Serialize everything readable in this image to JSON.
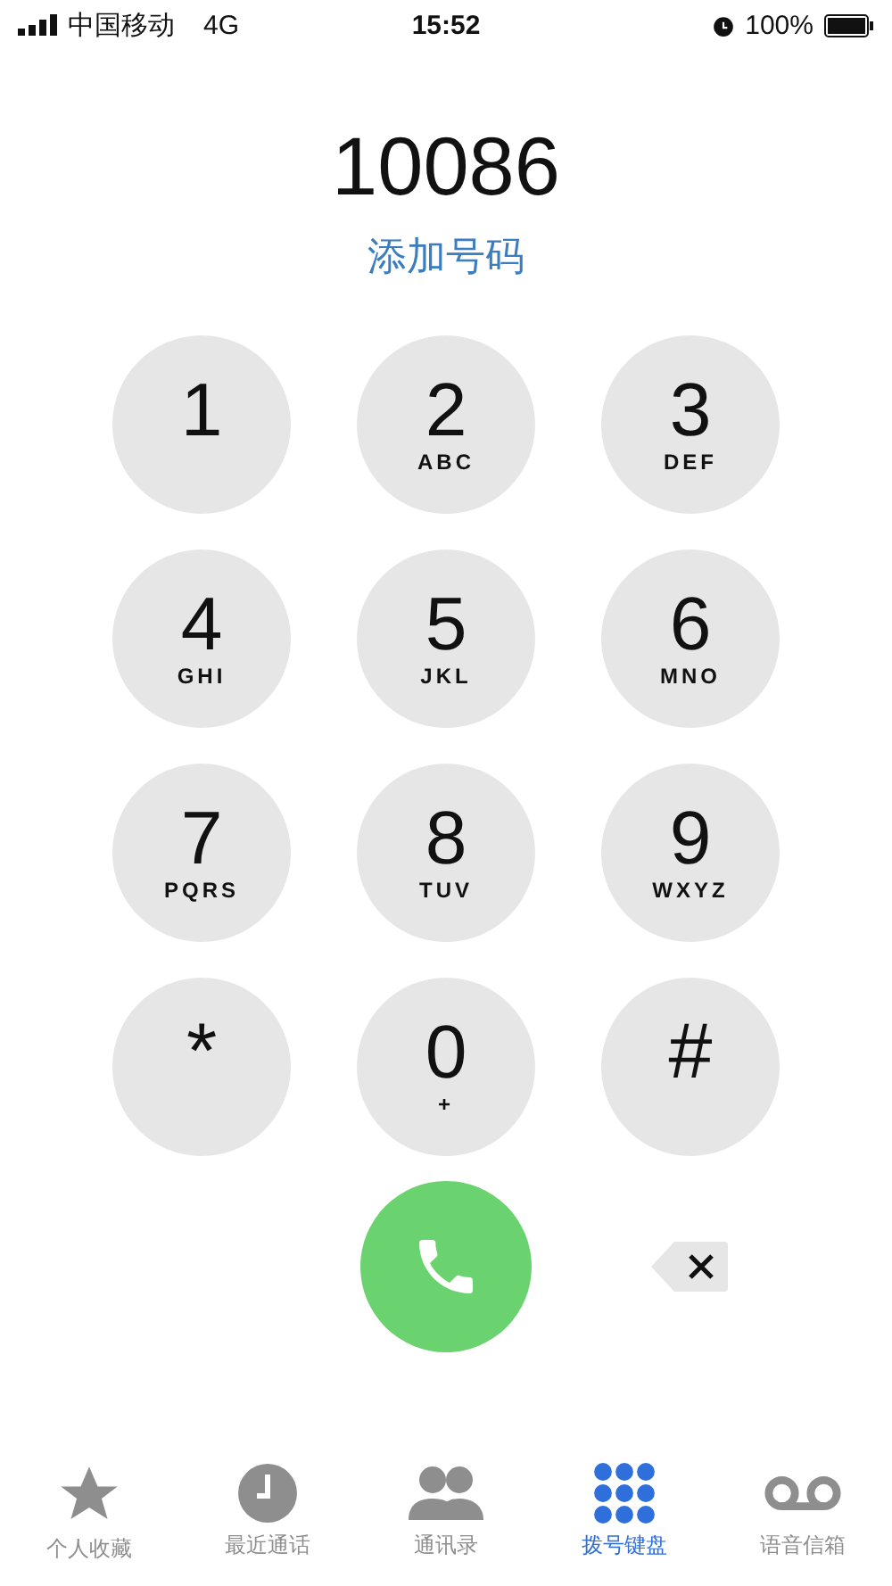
{
  "status_bar": {
    "carrier": "中国移动",
    "network": "4G",
    "time": "15:52",
    "battery": "100%"
  },
  "number": "10086",
  "add_number": "添加号码",
  "keys": [
    {
      "digit": "1"
    },
    {
      "digit": "2",
      "letters": "ABC"
    },
    {
      "digit": "3",
      "letters": "DEF"
    },
    {
      "digit": "4",
      "letters": "GHI"
    },
    {
      "digit": "5",
      "letters": "JKL"
    },
    {
      "digit": "6",
      "letters": "MNO"
    },
    {
      "digit": "7",
      "letters": "PQRS"
    },
    {
      "digit": "8",
      "letters": "TUV"
    },
    {
      "digit": "9",
      "letters": "WXYZ"
    },
    {
      "digit": "*"
    },
    {
      "digit": "0",
      "letters": "+"
    },
    {
      "digit": "#"
    }
  ],
  "tabs": [
    {
      "kind": "favorites",
      "label": "个人收藏",
      "selected": false
    },
    {
      "kind": "recents",
      "label": "最近通话",
      "selected": false
    },
    {
      "kind": "contacts",
      "label": "通讯录",
      "selected": false
    },
    {
      "kind": "keypad",
      "label": "拨号键盘",
      "selected": true
    },
    {
      "kind": "voicemail",
      "label": "语音信箱",
      "selected": false
    }
  ]
}
